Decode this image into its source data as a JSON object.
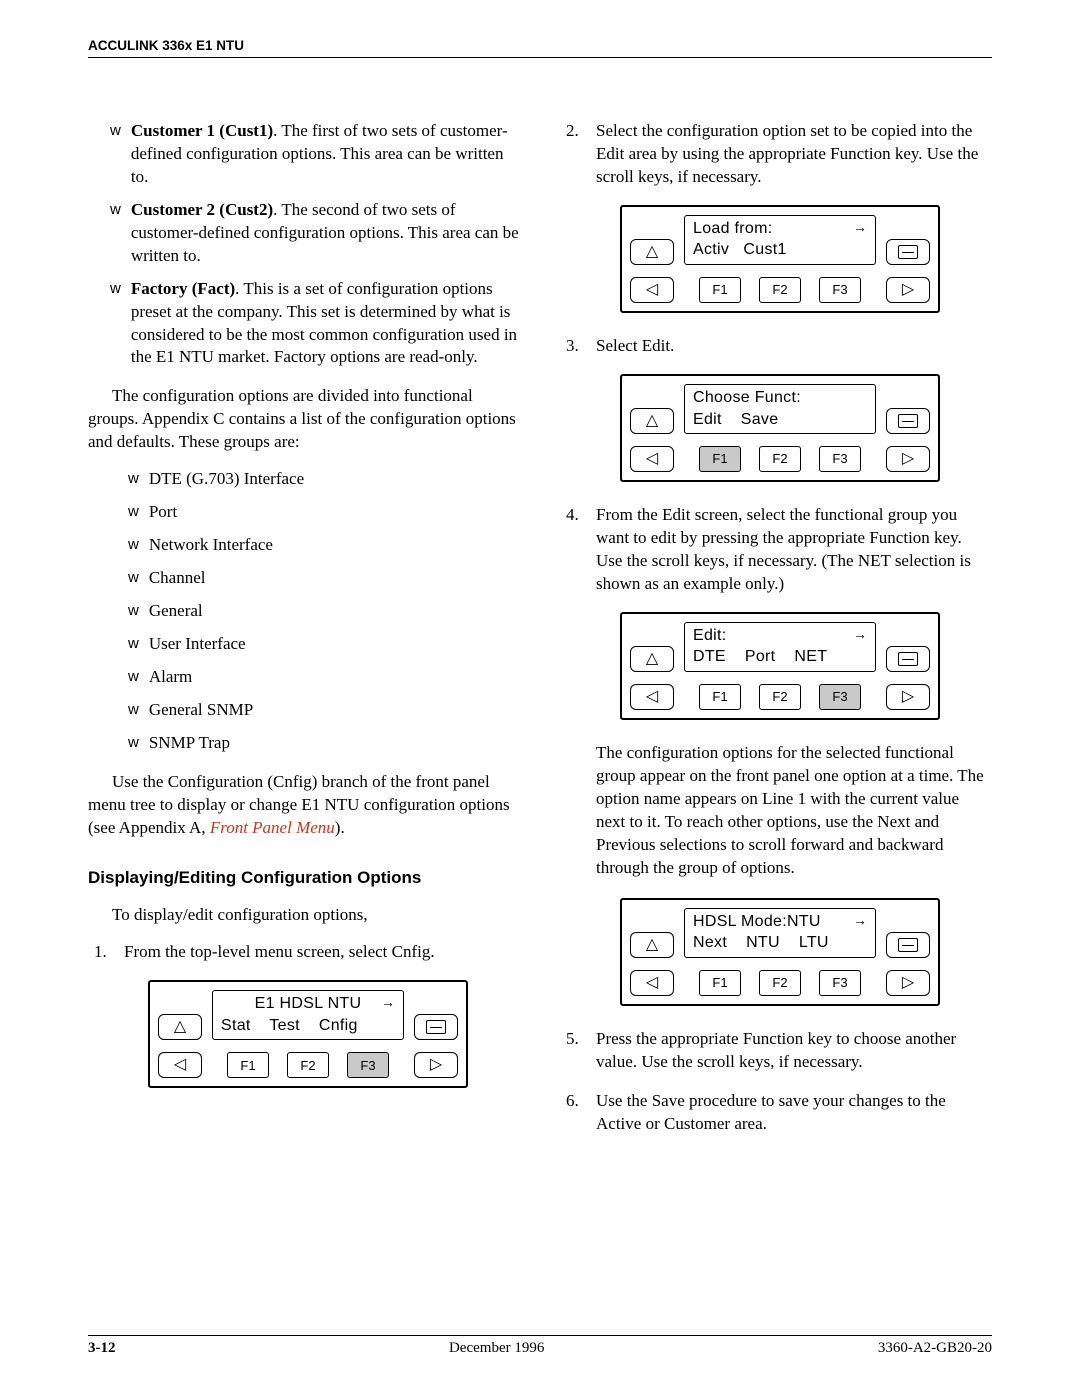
{
  "header": {
    "running": "ACCULINK 336x E1 NTU"
  },
  "left": {
    "config_areas": [
      {
        "label": "Customer 1 (Cust1)",
        "desc": ". The first of two sets of customer-defined configuration options. This area can be written to."
      },
      {
        "label": "Customer 2 (Cust2)",
        "desc": ". The second of two sets of customer-defined configuration options. This area can be written to."
      },
      {
        "label": "Factory (Fact)",
        "desc": ". This is a set of configuration options preset at the company. This set is determined by what is considered to be the most common configuration used in the E1 NTU market. Factory options are read-only."
      }
    ],
    "groups_intro": "The configuration options are divided into functional groups. Appendix C contains a list of the configuration options and defaults. These groups are:",
    "groups": [
      "DTE (G.703) Interface",
      "Port",
      "Network Interface",
      "Channel",
      "General",
      "User Interface",
      "Alarm",
      "General SNMP",
      "SNMP Trap"
    ],
    "use_cnfig_pre": "Use the Configuration (Cnfig) branch of the front panel menu tree to display or change E1 NTU configuration options (see Appendix A, ",
    "use_cnfig_link": "Front Panel Menu",
    "use_cnfig_post": ").",
    "subheading": "Displaying/Editing Configuration Options",
    "to_display": "To display/edit configuration options,",
    "step1": "From the top-level menu screen, select Cnfig.",
    "lcd1": {
      "title": "E1 HDSL NTU",
      "line2": "Stat    Test    Cnfig",
      "show_arrow": true,
      "highlight": "F3"
    }
  },
  "right": {
    "step2": "Select the configuration option set to be copied into the Edit area by using the appropriate Function key. Use the scroll keys, if necessary.",
    "lcd2": {
      "title": "Load from:",
      "line2": "Activ   Cust1",
      "show_arrow": true,
      "highlight": ""
    },
    "step3": "Select Edit.",
    "lcd3": {
      "title": "Choose Funct:",
      "line2": "Edit    Save",
      "show_arrow": false,
      "highlight": "F1"
    },
    "step4": "From the Edit screen, select the functional group you want to edit by pressing the appropriate Function key. Use the scroll keys, if necessary. (The NET selection is shown as an example only.)",
    "lcd4": {
      "title": "Edit:",
      "line2": "DTE    Port    NET",
      "show_arrow": true,
      "highlight": "F3"
    },
    "para_after4": "The configuration options for the selected functional group appear on the front panel one option at a time. The option name appears on Line 1 with the current value next to it. To reach other options, use the Next and Previous selections to scroll forward and backward through the group of options.",
    "lcd5": {
      "title": "HDSL Mode:NTU",
      "line2": "Next    NTU    LTU",
      "show_arrow": true,
      "highlight": ""
    },
    "step5": "Press the appropriate Function key to choose another value. Use the scroll keys, if necessary.",
    "step6": "Use the Save procedure to save your changes to the Active or Customer area."
  },
  "fkeys": {
    "f1": "F1",
    "f2": "F2",
    "f3": "F3"
  },
  "footer": {
    "page": "3-12",
    "date": "December 1996",
    "docnum": "3360-A2-GB20-20"
  },
  "bullet_glyph": "w"
}
